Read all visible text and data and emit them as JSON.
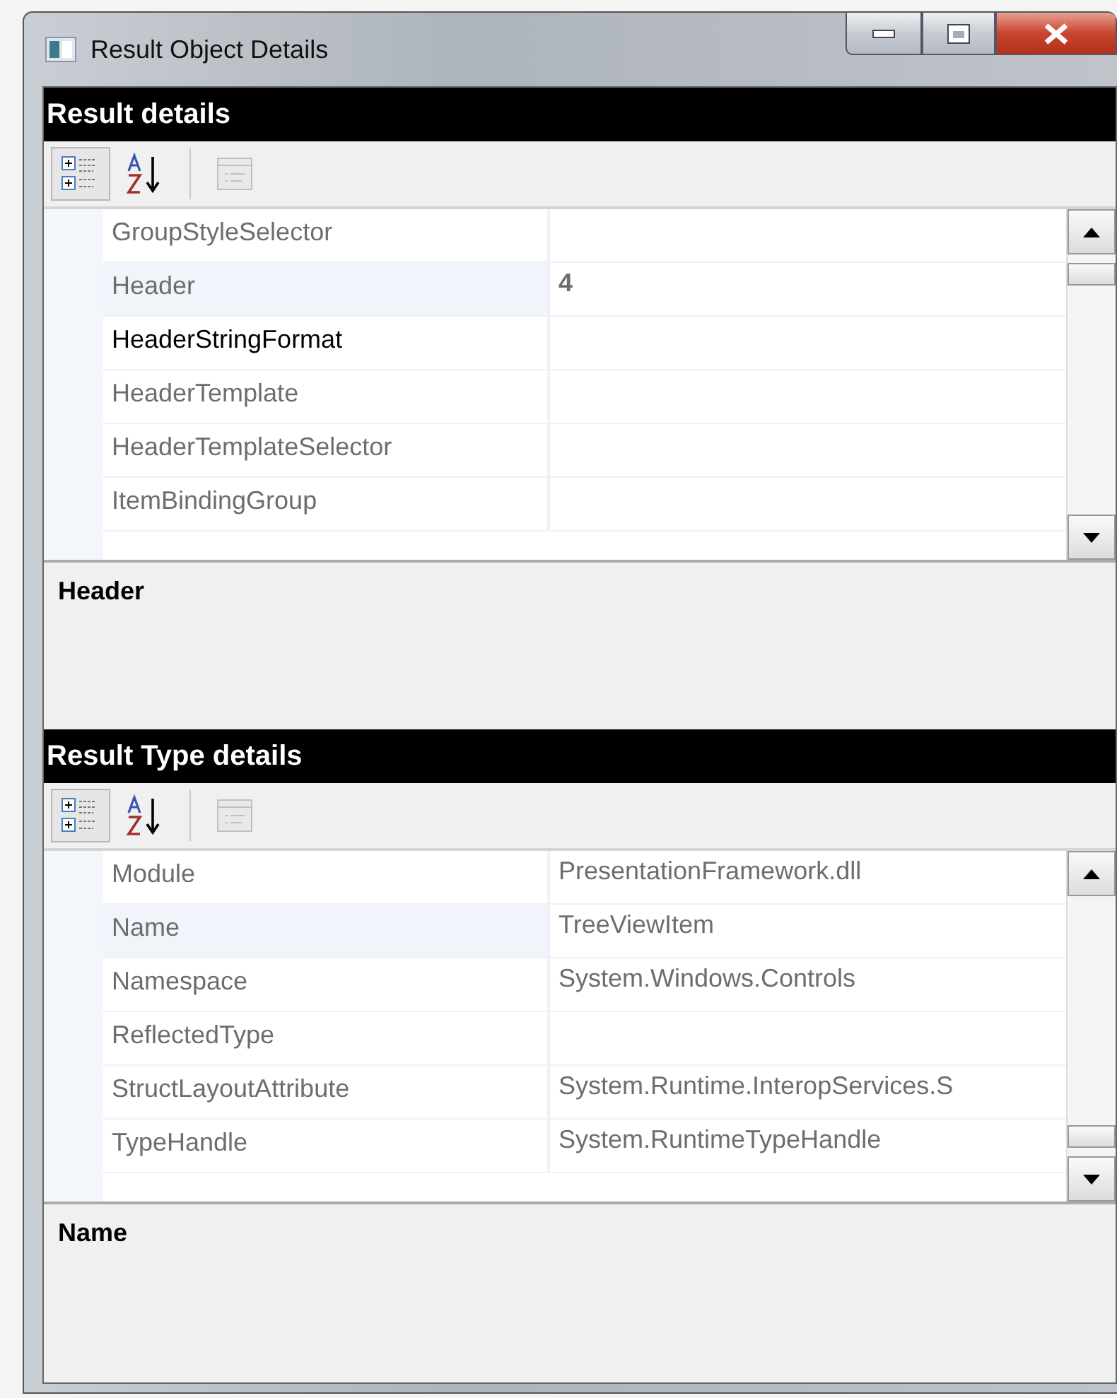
{
  "window": {
    "title": "Result Object Details"
  },
  "sections": [
    {
      "title": "Result details",
      "toolbar": [
        {
          "kind": "categorized",
          "selected": true,
          "disabled": false
        },
        {
          "kind": "alphabetical",
          "selected": false,
          "disabled": false
        },
        {
          "kind": "pages",
          "selected": false,
          "disabled": true
        }
      ],
      "rows": [
        {
          "name": "GroupStyleSelector",
          "selected": false,
          "modified": false
        },
        {
          "name": "Header",
          "value": "4",
          "selected": true,
          "modified": false
        },
        {
          "name": "HeaderStringFormat",
          "selected": false,
          "modified": true
        },
        {
          "name": "HeaderTemplate",
          "selected": false,
          "modified": false
        },
        {
          "name": "HeaderTemplateSelector",
          "selected": false,
          "modified": false
        },
        {
          "name": "ItemBindingGroup",
          "selected": false,
          "modified": false
        }
      ],
      "description": "Header"
    },
    {
      "title": "Result Type details",
      "toolbar": [
        {
          "kind": "categorized",
          "selected": true,
          "disabled": false
        },
        {
          "kind": "alphabetical",
          "selected": false,
          "disabled": false
        },
        {
          "kind": "pages",
          "selected": false,
          "disabled": true
        }
      ],
      "rows": [
        {
          "name": "Module",
          "value": "PresentationFramework.dll",
          "selected": false,
          "modified": false
        },
        {
          "name": "Name",
          "value": "TreeViewItem",
          "selected": true,
          "modified": false
        },
        {
          "name": "Namespace",
          "value": "System.Windows.Controls",
          "selected": false,
          "modified": false
        },
        {
          "name": "ReflectedType",
          "selected": false,
          "modified": false
        },
        {
          "name": "StructLayoutAttribute",
          "value": "System.Runtime.InteropServices.S",
          "selected": false,
          "modified": false
        },
        {
          "name": "TypeHandle",
          "value": "System.RuntimeTypeHandle",
          "selected": false,
          "modified": false
        }
      ],
      "description": "Name"
    }
  ]
}
